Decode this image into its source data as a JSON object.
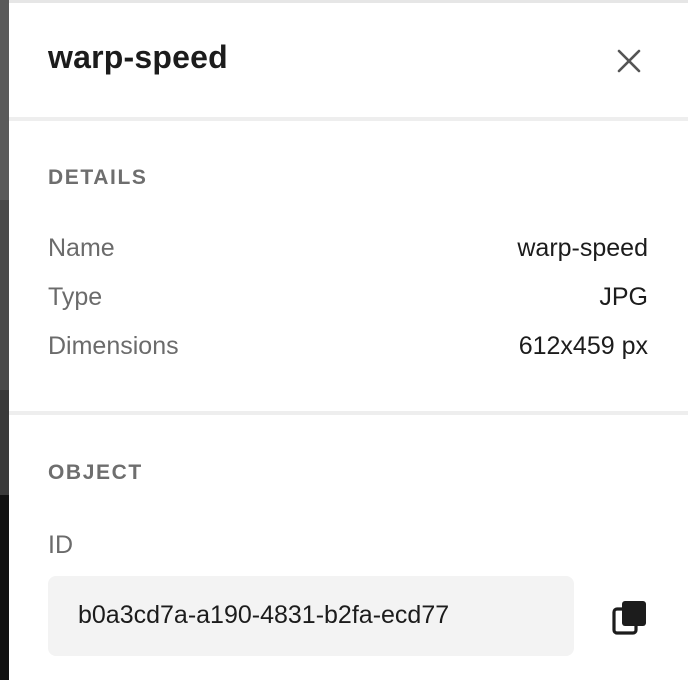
{
  "header": {
    "title": "warp-speed",
    "close_icon": "close-icon"
  },
  "details": {
    "section_title": "DETAILS",
    "rows": [
      {
        "label": "Name",
        "value": "warp-speed"
      },
      {
        "label": "Type",
        "value": "JPG"
      },
      {
        "label": "Dimensions",
        "value": "612x459 px"
      }
    ]
  },
  "object": {
    "section_title": "OBJECT",
    "id_label": "ID",
    "id_value": "b0a3cd7a-a190-4831-b2fa-ecd77",
    "copy_icon": "copy-icon"
  }
}
